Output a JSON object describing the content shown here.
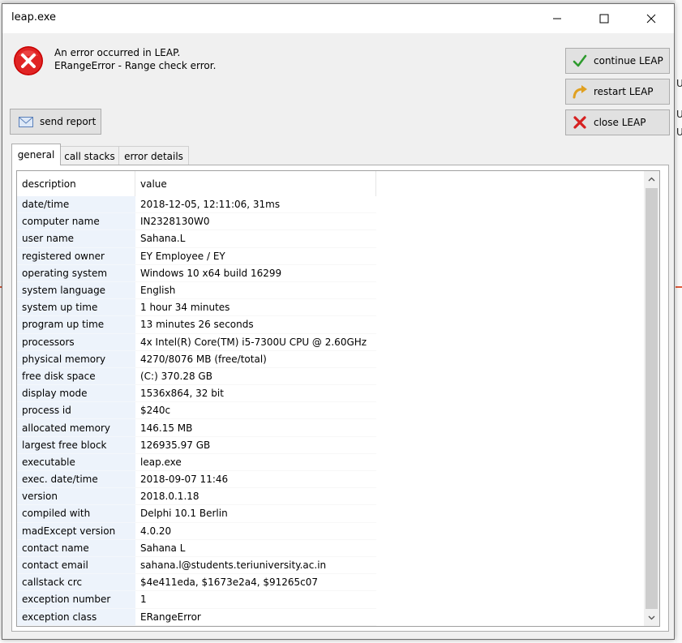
{
  "window": {
    "title": "leap.exe"
  },
  "message": {
    "line1": "An error occurred in LEAP.",
    "line2": "ERangeError - Range check error."
  },
  "buttons": {
    "send_report": "send report",
    "continue": "continue LEAP",
    "restart": "restart LEAP",
    "close": "close LEAP"
  },
  "tabs": [
    "general",
    "call stacks",
    "error details"
  ],
  "table": {
    "headers": [
      "description",
      "value"
    ],
    "rows": [
      [
        "date/time",
        "2018-12-05, 12:11:06, 31ms"
      ],
      [
        "computer name",
        "IN2328130W0"
      ],
      [
        "user name",
        "Sahana.L"
      ],
      [
        "registered owner",
        "EY Employee / EY"
      ],
      [
        "operating system",
        "Windows 10 x64 build 16299"
      ],
      [
        "system language",
        "English"
      ],
      [
        "system up time",
        "1 hour 34 minutes"
      ],
      [
        "program up time",
        "13 minutes 26 seconds"
      ],
      [
        "processors",
        "4x Intel(R) Core(TM) i5-7300U CPU @ 2.60GHz"
      ],
      [
        "physical memory",
        "4270/8076 MB (free/total)"
      ],
      [
        "free disk space",
        "(C:) 370.28 GB"
      ],
      [
        "display mode",
        "1536x864, 32 bit"
      ],
      [
        "process id",
        "$240c"
      ],
      [
        "allocated memory",
        "146.15 MB"
      ],
      [
        "largest free block",
        "126935.97 GB"
      ],
      [
        "executable",
        "leap.exe"
      ],
      [
        "exec. date/time",
        "2018-09-07 11:46"
      ],
      [
        "version",
        "2018.0.1.18"
      ],
      [
        "compiled with",
        "Delphi 10.1 Berlin"
      ],
      [
        "madExcept version",
        "4.0.20"
      ],
      [
        "contact name",
        "Sahana L"
      ],
      [
        "contact email",
        "sahana.l@students.teriuniversity.ac.in"
      ],
      [
        "callstack crc",
        "$4e411eda, $1673e2a4, $91265c07"
      ],
      [
        "exception number",
        "1"
      ],
      [
        "exception class",
        "ERangeError"
      ]
    ]
  },
  "background_text": [
    "U",
    "U",
    "U"
  ],
  "icons": {
    "error": "error-x-icon",
    "send": "envelope-icon",
    "continue": "checkmark-icon",
    "restart": "restart-arrow-icon",
    "close": "red-x-icon"
  }
}
